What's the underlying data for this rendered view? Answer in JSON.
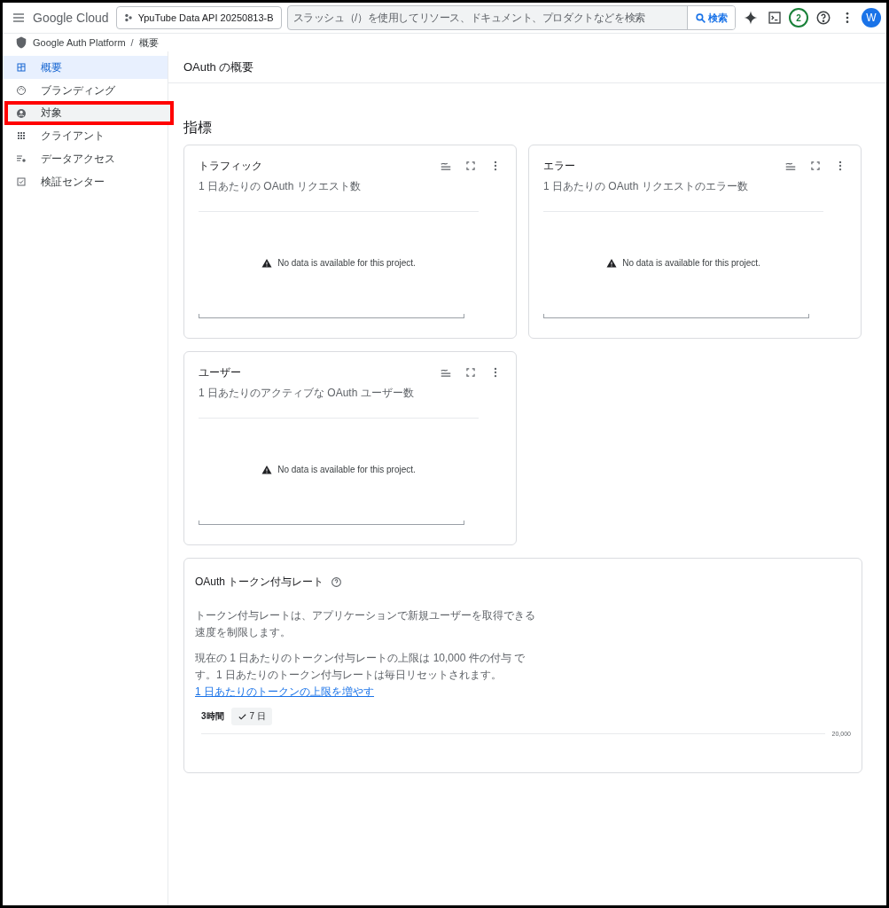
{
  "header": {
    "logo": "Google Cloud",
    "project": "YpuTube Data API 20250813-B",
    "search_placeholder": "スラッシュ（/）を使用してリソース、ドキュメント、プロダクトなどを検索",
    "search_button": "検索",
    "notifications": "2",
    "avatar": "W"
  },
  "breadcrumb": {
    "separator": "/",
    "items": [
      "Google Auth Platform",
      "概要"
    ]
  },
  "sidebar": {
    "items": [
      {
        "label": "概要",
        "selected": true,
        "highlighted": false
      },
      {
        "label": "ブランディング",
        "selected": false,
        "highlighted": false
      },
      {
        "label": "対象",
        "selected": false,
        "highlighted": true
      },
      {
        "label": "クライアント",
        "selected": false,
        "highlighted": false
      },
      {
        "label": "データアクセス",
        "selected": false,
        "highlighted": false
      },
      {
        "label": "検証センター",
        "selected": false,
        "highlighted": false
      }
    ]
  },
  "page_title": "OAuth の概要",
  "section_title": "指標",
  "metrics": [
    {
      "title": "トラフィック",
      "subtitle": "1 日あたりの OAuth リクエスト数",
      "message": "No data is available for this project."
    },
    {
      "title": "エラー",
      "subtitle": "1 日あたりの OAuth リクエストのエラー数",
      "message": "No data is available for this project."
    },
    {
      "title": "ユーザー",
      "subtitle": "1 日あたりのアクティブな OAuth ユーザー数",
      "message": "No data is available for this project."
    }
  ],
  "token_card": {
    "title": "OAuth トークン付与レート",
    "paragraph_1": "トークン付与レートは、アプリケーションで新規ユーザーを取得できる速度を制限します。",
    "paragraph_2": "現在の 1 日あたりのトークン付与レートの上限は 10,000 件の付与 です。1 日あたりのトークン付与レートは毎日リセットされます。",
    "link": "1 日あたりのトークンの上限を増やす",
    "ranges": [
      {
        "label": "3時間",
        "selected": false
      },
      {
        "label": "7 日",
        "selected": true
      }
    ],
    "y_tick_label": "20,000"
  }
}
